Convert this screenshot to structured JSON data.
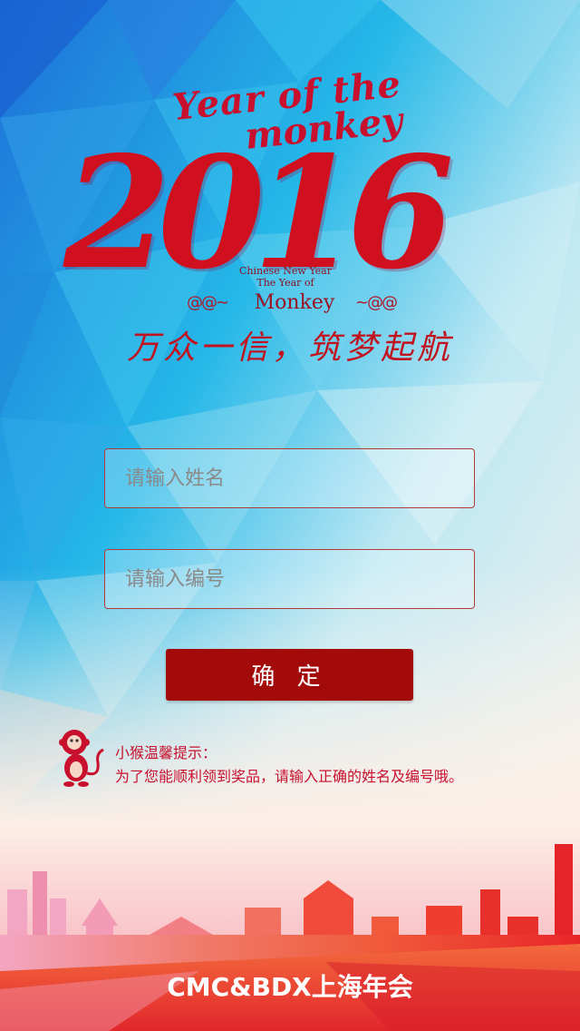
{
  "hero": {
    "script_line1": "Year of the",
    "script_line2": "monkey",
    "year": "2016",
    "cny_line1": "Chinese New Year",
    "cny_line2": "The Year of",
    "cny_monkey": "Monkey",
    "slogan": "万众一信，筑梦起航"
  },
  "form": {
    "name_placeholder": "请输入姓名",
    "id_placeholder": "请输入编号",
    "confirm_label": "确 定"
  },
  "tip": {
    "title": "小猴温馨提示：",
    "text": "为了您能顺利领到奖品，请输入正确的姓名及编号哦。"
  },
  "footer": {
    "title": "CMC&BDX上海年会"
  },
  "colors": {
    "brand_red": "#c8102e",
    "button_red": "#a30b0b",
    "sky_blue": "#2fb8e6"
  }
}
